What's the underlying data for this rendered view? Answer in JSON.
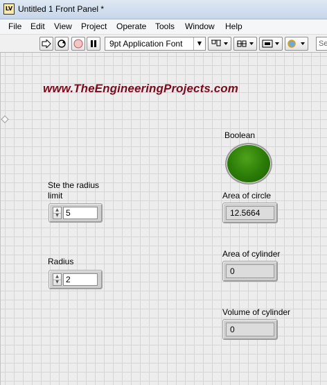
{
  "window": {
    "app_icon_text": "LV",
    "title": "Untitled 1 Front Panel *"
  },
  "menu": {
    "items": [
      {
        "label": "File"
      },
      {
        "label": "Edit"
      },
      {
        "label": "View"
      },
      {
        "label": "Project"
      },
      {
        "label": "Operate"
      },
      {
        "label": "Tools"
      },
      {
        "label": "Window"
      },
      {
        "label": "Help"
      }
    ]
  },
  "toolbar": {
    "run_icon": "run-arrow-icon",
    "run_continuously_icon": "run-continuously-icon",
    "abort_icon": "abort-stop-icon",
    "pause_icon": "pause-icon",
    "font_setting": "9pt Application Font",
    "align_icon": "align-objects-icon",
    "distribute_icon": "distribute-objects-icon",
    "resize_icon": "resize-objects-icon",
    "reorder_icon": "reorder-icon",
    "search_placeholder": "Se"
  },
  "panel": {
    "website_text": "www.TheEngineeringProjects.com",
    "radius_limit": {
      "label_line1": "Ste the radius",
      "label_line2": "limit",
      "value": "5"
    },
    "radius": {
      "label": "Radius",
      "value": "2"
    },
    "boolean": {
      "label": "Boolean",
      "state": "on",
      "color": "#2c7d08"
    },
    "area_circle": {
      "label": "Area of circle",
      "value": "12.5664"
    },
    "area_cylinder": {
      "label": "Area of cylinder",
      "value": "0"
    },
    "volume_cylinder": {
      "label": "Volume of cylinder",
      "value": "0"
    }
  },
  "colors": {
    "website_text": "#7b0a1c",
    "grid_line": "#d6d6d6",
    "panel_bg": "#ededed"
  }
}
